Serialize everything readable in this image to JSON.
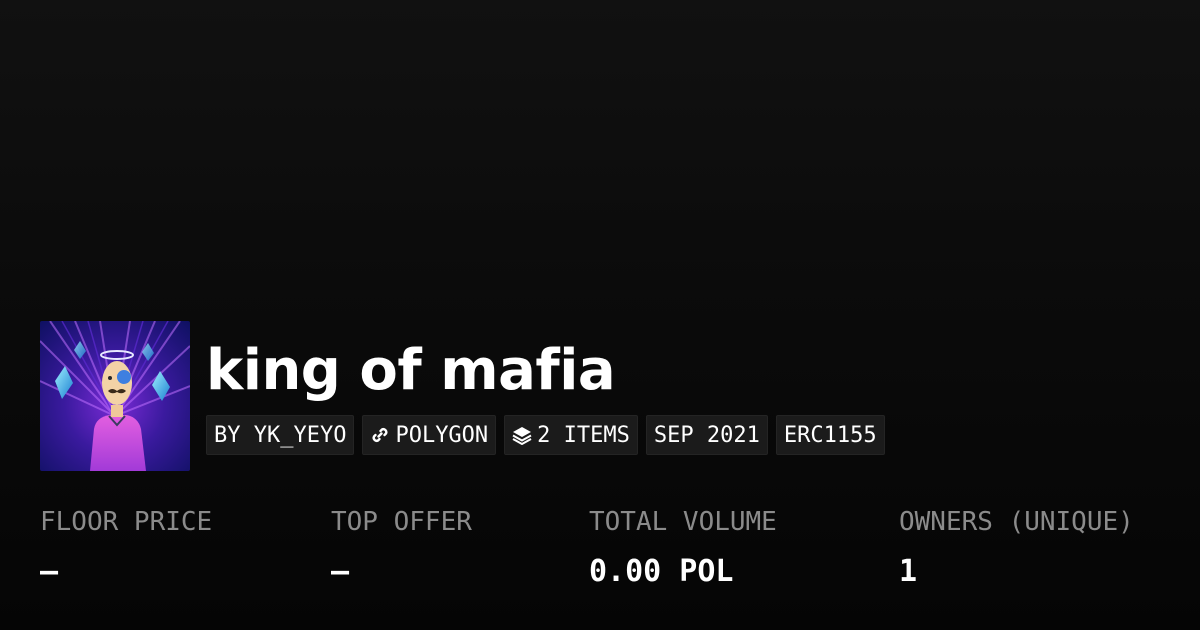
{
  "collection": {
    "title": "king of mafia",
    "avatar_alt": "king of mafia avatar"
  },
  "tags": {
    "creator": "BY YK_YEYO",
    "chain": "POLYGON",
    "chain_icon": "link-icon",
    "items": "2 ITEMS",
    "items_icon": "layers-icon",
    "date": "SEP 2021",
    "standard": "ERC1155"
  },
  "stats": {
    "floor_price": {
      "label": "FLOOR PRICE",
      "value": "–"
    },
    "top_offer": {
      "label": "TOP OFFER",
      "value": "–"
    },
    "total_volume": {
      "label": "TOTAL VOLUME",
      "value": "0.00 POL"
    },
    "owners": {
      "label": "OWNERS (UNIQUE)",
      "value": "1"
    }
  },
  "colors": {
    "background": "#0b0b0b",
    "tag_background": "#1b1b1b",
    "label_gray": "#8b8b8b",
    "text": "#ffffff"
  }
}
